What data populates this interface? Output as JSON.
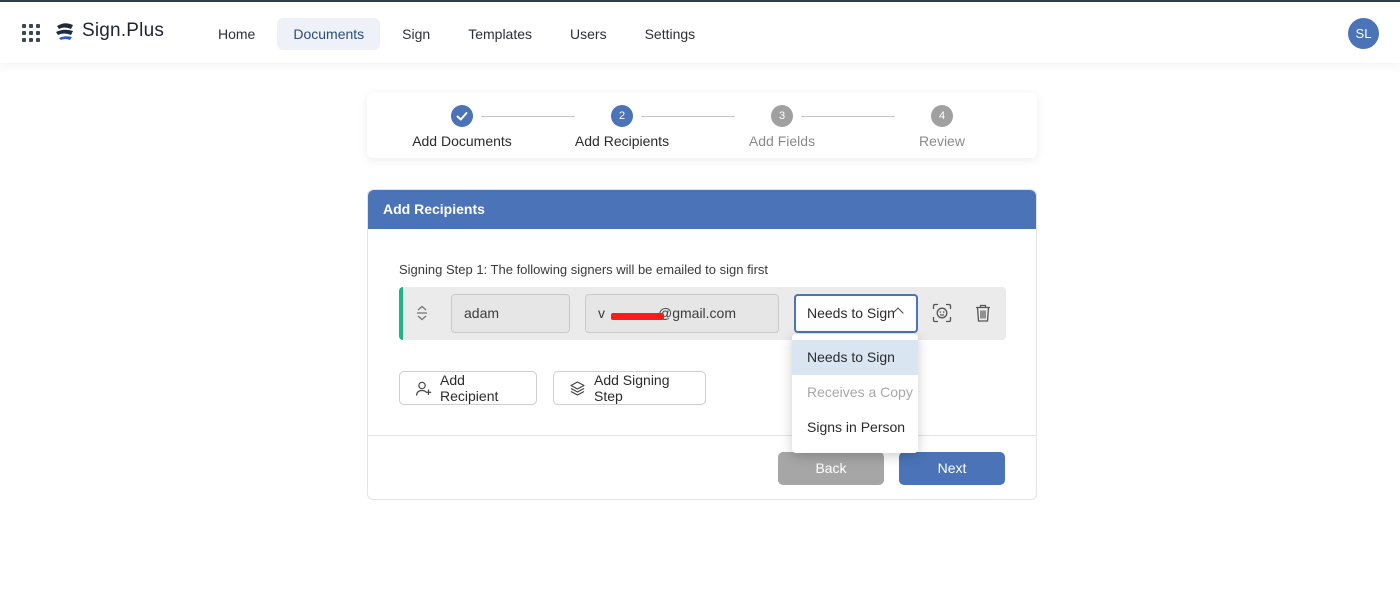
{
  "app": {
    "brand": "Sign.Plus",
    "nav": [
      "Home",
      "Documents",
      "Sign",
      "Templates",
      "Users",
      "Settings"
    ],
    "active_nav": "Documents",
    "user_initials": "SL"
  },
  "stepper": {
    "steps": [
      {
        "number": "1",
        "label": "Add Documents",
        "state": "done"
      },
      {
        "number": "2",
        "label": "Add Recipients",
        "state": "current"
      },
      {
        "number": "3",
        "label": "Add Fields",
        "state": "todo"
      },
      {
        "number": "4",
        "label": "Review",
        "state": "todo"
      }
    ]
  },
  "recipients_panel": {
    "title": "Add Recipients",
    "signing_step_caption": "Signing Step 1: The following signers will be emailed to sign first",
    "recipient": {
      "name": "adam",
      "email_prefix": "v",
      "email_suffix": "@gmail.com",
      "role": "Needs to Sign"
    },
    "add_recipient_label": "Add Recipient",
    "add_signing_step_label": "Add Signing Step",
    "back_label": "Back",
    "next_label": "Next"
  },
  "role_dropdown": {
    "options": [
      {
        "label": "Needs to Sign",
        "state": "selected"
      },
      {
        "label": "Receives a Copy",
        "state": "disabled"
      },
      {
        "label": "Signs in Person",
        "state": "normal"
      }
    ]
  },
  "colors": {
    "primary": "#4a73b8",
    "row_accent": "#1fb38a",
    "redaction": "#ff1a1a"
  }
}
